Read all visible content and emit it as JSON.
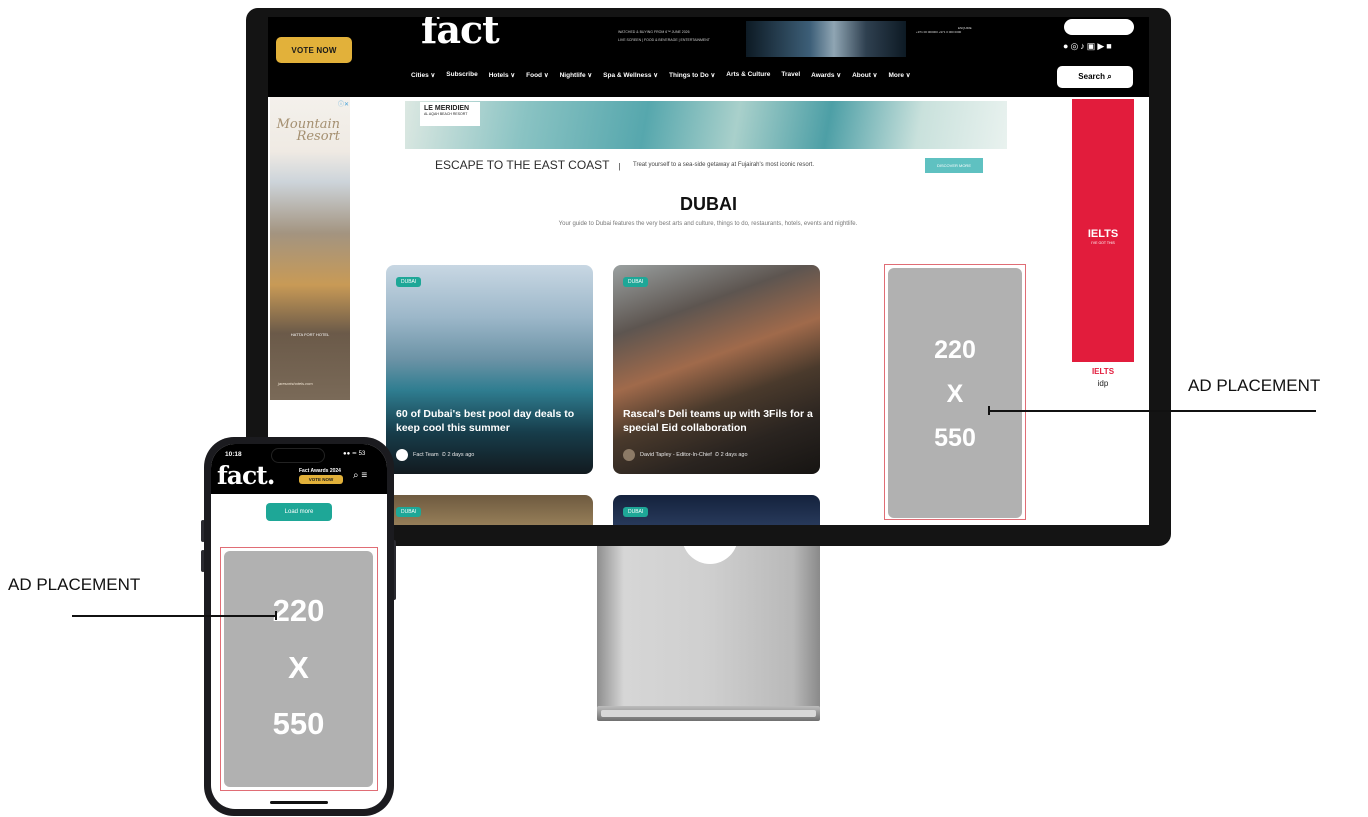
{
  "desktop": {
    "header": {
      "vote_button": "VOTE NOW",
      "logo": "fact",
      "ticker_line1": "WATCHED & BUYING FROM 6™ JUNE 2026",
      "ticker_line2": "LIVE SCREEN | FOOD & BEVERAGE | ENTERTAINMENT",
      "enquire_label": "ENQUIRE",
      "enquire_phone": "+971 00 000000  +971 0 000 0000",
      "social_icons": [
        "facebook-icon",
        "instagram-icon",
        "tiktok-icon",
        "threads-icon",
        "youtube-icon",
        "linkedin-icon"
      ],
      "nav": [
        "Cities ∨",
        "Subscribe",
        "Hotels ∨",
        "Food ∨",
        "Nightlife ∨",
        "Spa & Wellness ∨",
        "Things to Do ∨",
        "Arts & Culture",
        "Travel",
        "Awards ∨",
        "About ∨",
        "More ∨"
      ],
      "search_button": "Search ⌕"
    },
    "left_ad": {
      "title": "Mountain Resort",
      "hotel": "HATTA FORT HOTEL",
      "url": "jaresortshotels.com"
    },
    "right_ad": {
      "brand": "IELTS",
      "tagline": "I'VE GOT THIS",
      "footer_brand": "IELTS",
      "footer_logo": "idp"
    },
    "banner": {
      "brand": "LE MERIDIEN",
      "brand_sub": "AL AQAH BEACH RESORT",
      "headline": "ESCAPE TO THE EAST COAST",
      "separator": "|",
      "subline": "Treat yourself to a sea-side getaway at Fujairah's most iconic resort.",
      "cta": "DISCOVER MORE"
    },
    "city": {
      "title": "DUBAI",
      "description": "Your guide to Dubai features the very best arts and culture, things to do, restaurants, hotels, events and nightlife."
    },
    "cards": [
      {
        "tag": "DUBAI",
        "title": "60 of Dubai's best pool day deals to keep cool this summer",
        "author": "Fact Team",
        "time": "⏲ 2 days ago"
      },
      {
        "tag": "DUBAI",
        "title": "Rascal's Deli teams up with 3Fils for a special Eid collaboration",
        "author": "David Tapley - Editor-In-Chief",
        "time": "⏲ 2 days ago"
      },
      {
        "tag": "DUBAI"
      },
      {
        "tag": "DUBAI"
      }
    ],
    "placeholder": {
      "line1": "220",
      "line2": "X",
      "line3": "550"
    }
  },
  "mobile": {
    "time": "10:18",
    "status": "●● ≃ 53",
    "logo": "fact.",
    "awards_label": "Fact Awards 2024",
    "vote_button": "VOTE NOW",
    "icons": "⌕ ≡",
    "load_more": "Load more",
    "placeholder": {
      "line1": "220",
      "line2": "X",
      "line3": "550"
    }
  },
  "callouts": {
    "right": "AD PLACEMENT",
    "left": "AD PLACEMENT"
  },
  "colors": {
    "accent_teal": "#1ea797",
    "vote_gold": "#e2b13a",
    "placeholder_gray": "#b1b1b1",
    "placeholder_border": "#e06d75",
    "ielts_red": "#e21c3c"
  }
}
